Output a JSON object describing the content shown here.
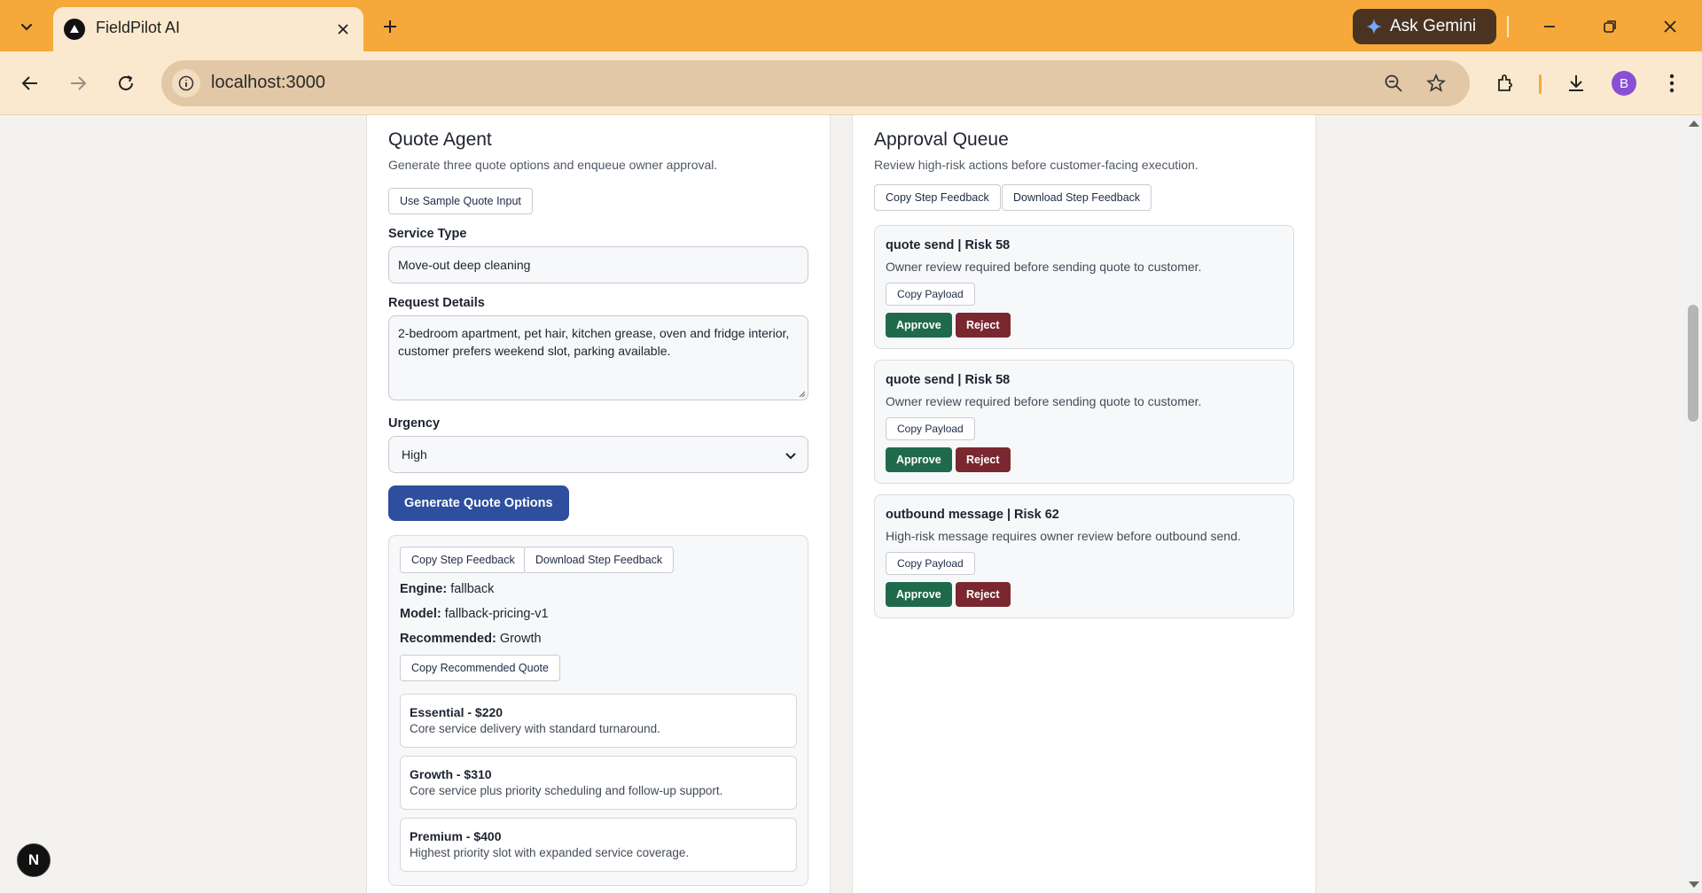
{
  "browser": {
    "tab_title": "FieldPilot AI",
    "url": "localhost:3000",
    "gemini_label": "Ask Gemini",
    "profile_initial": "B"
  },
  "quote_agent": {
    "title": "Quote Agent",
    "subtitle": "Generate three quote options and enqueue owner approval.",
    "sample_button": "Use Sample Quote Input",
    "service_type_label": "Service Type",
    "service_type_value": "Move-out deep cleaning",
    "request_details_label": "Request Details",
    "request_details_value": "2-bedroom apartment, pet hair, kitchen grease, oven and fridge interior, customer prefers weekend slot, parking available.",
    "urgency_label": "Urgency",
    "urgency_value": "High",
    "generate_button": "Generate Quote Options",
    "copy_feedback_button": "Copy Step Feedback",
    "download_feedback_button": "Download Step Feedback",
    "engine_label": "Engine:",
    "engine_value": "fallback",
    "model_label": "Model:",
    "model_value": "fallback-pricing-v1",
    "recommended_label": "Recommended:",
    "recommended_value": "Growth",
    "copy_recommended_button": "Copy Recommended Quote",
    "options": [
      {
        "title": "Essential - $220",
        "desc": "Core service delivery with standard turnaround."
      },
      {
        "title": "Growth - $310",
        "desc": "Core service plus priority scheduling and follow-up support."
      },
      {
        "title": "Premium - $400",
        "desc": "Highest priority slot with expanded service coverage."
      }
    ]
  },
  "approval_queue": {
    "title": "Approval Queue",
    "subtitle": "Review high-risk actions before customer-facing execution.",
    "copy_feedback_button": "Copy Step Feedback",
    "download_feedback_button": "Download Step Feedback",
    "items": [
      {
        "title": "quote send | Risk 58",
        "desc": "Owner review required before sending quote to customer.",
        "copy": "Copy Payload",
        "approve": "Approve",
        "reject": "Reject"
      },
      {
        "title": "quote send | Risk 58",
        "desc": "Owner review required before sending quote to customer.",
        "copy": "Copy Payload",
        "approve": "Approve",
        "reject": "Reject"
      },
      {
        "title": "outbound message | Risk 62",
        "desc": "High-risk message requires owner review before outbound send.",
        "copy": "Copy Payload",
        "approve": "Approve",
        "reject": "Reject"
      }
    ]
  },
  "dev_badge": "N",
  "colors": {
    "tabbar": "#f6a93a",
    "toolbar": "#fbe9cf",
    "primary": "#2e4e9e",
    "approve": "#1f6a4c",
    "reject": "#7a2730"
  }
}
